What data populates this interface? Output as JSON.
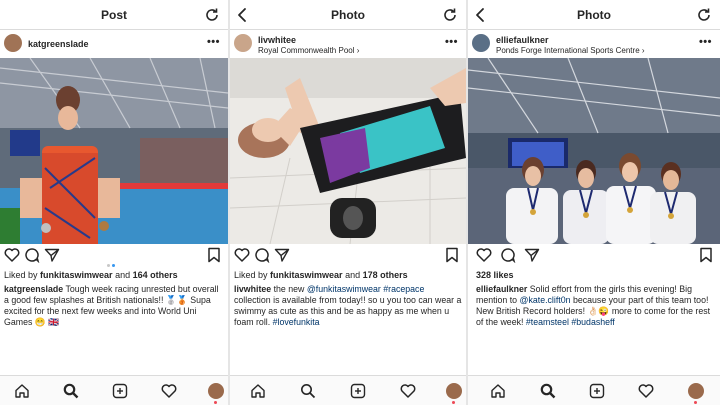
{
  "colors": {
    "link": "#003569",
    "text": "#262626",
    "border": "#dbdbdb",
    "notify": "#ed4956",
    "carousel_active": "#3897f0"
  },
  "posts": [
    {
      "header_title": "Post",
      "username": "katgreenslade",
      "location": "",
      "likes_by_prefix": "Liked by ",
      "likes_by_user": "funkitaswimwear",
      "likes_and": " and ",
      "likes_count": "164 others",
      "caption_user": "katgreenslade",
      "caption_text": " Tough week racing unrested but overall a good few splashes at British nationals!! 🥈🥉 Supa excited for the next few weeks and into World Uni Games 😁 🇬🇧",
      "carousel_dots": 2,
      "icons": [
        "back-arrow-icon",
        "refresh-icon",
        "heart-icon",
        "comment-icon",
        "share-icon",
        "bookmark-icon"
      ]
    },
    {
      "header_title": "Photo",
      "username": "livwhitee",
      "location": "Royal Commonwealth Pool ›",
      "likes_by_prefix": "Liked by ",
      "likes_by_user": "funkitaswimwear",
      "likes_and": " and ",
      "likes_count": "178 others",
      "caption_user": "livwhitee",
      "caption_pre": " the new ",
      "caption_mention": "@funkitaswimwear",
      "caption_hashtag1": "#racepace",
      "caption_mid": " collection is available from today!! so u you too can wear a swimmy as cute as this and be as happy as me when u foam roll. ",
      "caption_hashtag2": "#lovefunkita"
    },
    {
      "header_title": "Photo",
      "username": "elliefaulkner",
      "location": "Ponds Forge International Sports Centre ›",
      "likes_simple": "328 likes",
      "caption_user": "elliefaulkner",
      "caption_pre": " Solid effort from the girls this evening! Big mention to ",
      "caption_mention": "@kate.clift0n",
      "caption_mid": " because your part of this team too! New British Record holders! 👌🏻😜 more to come for the rest of the week! ",
      "caption_hashtag1": "#teamsteel",
      "caption_hashtag2": "#budasheff"
    }
  ],
  "bottom_nav": [
    "home-icon",
    "search-icon",
    "new-post-icon",
    "activity-icon",
    "profile-avatar"
  ]
}
